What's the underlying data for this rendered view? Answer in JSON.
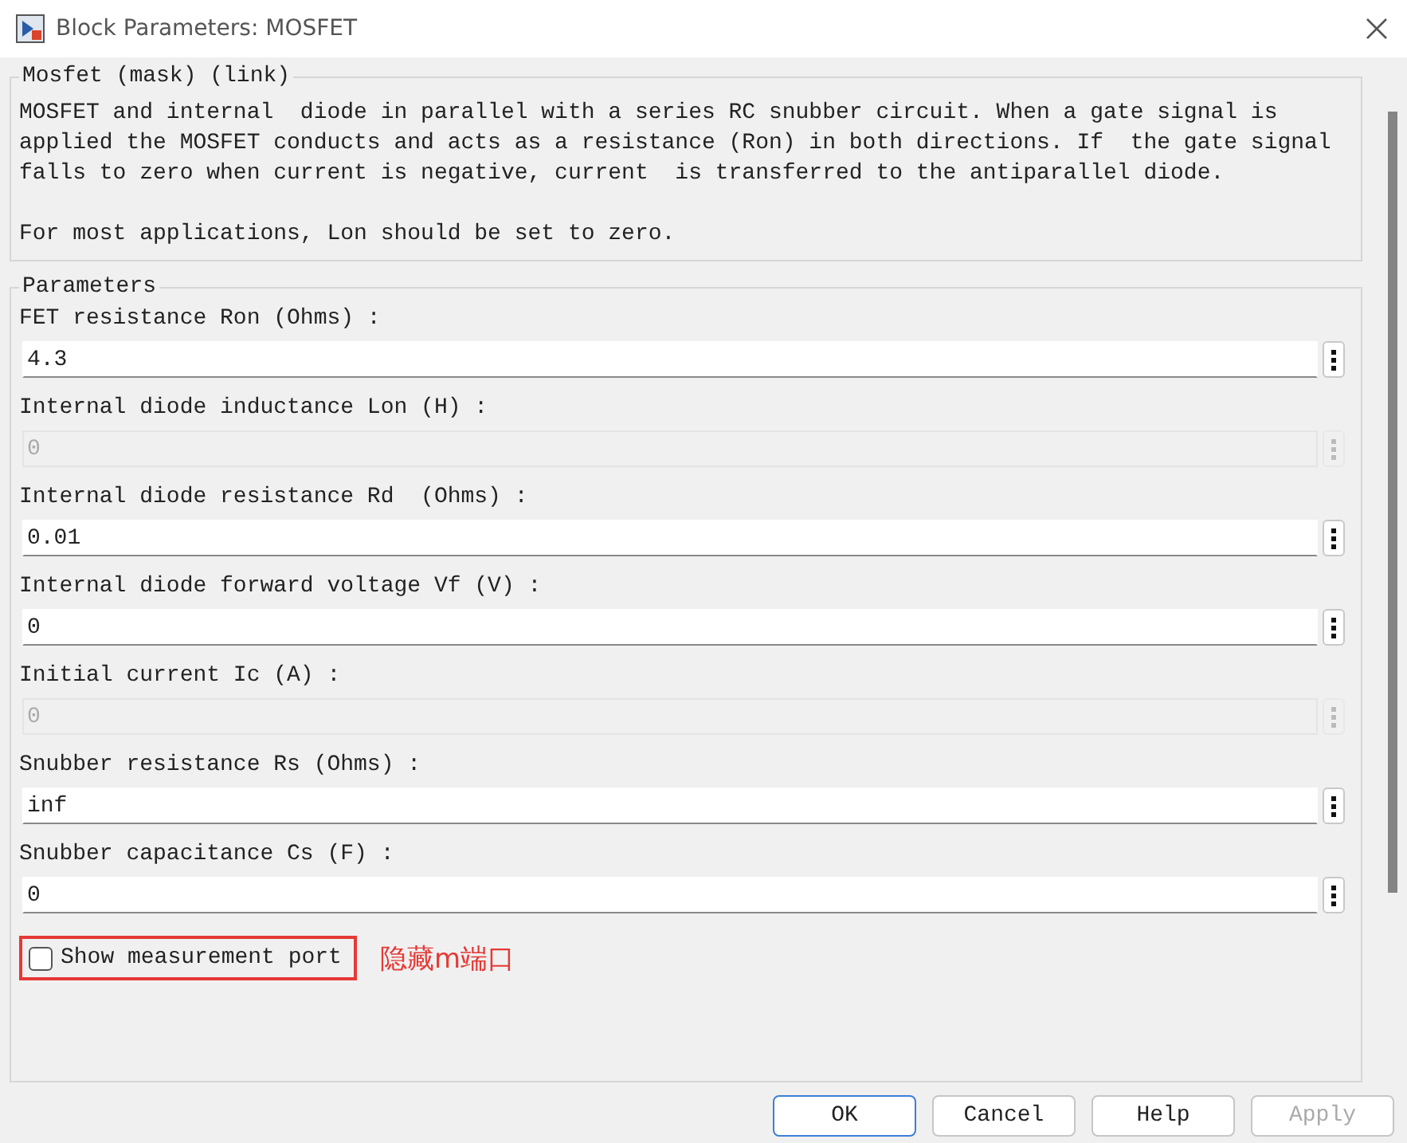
{
  "window": {
    "title": "Block Parameters: MOSFET"
  },
  "description": {
    "title": "Mosfet (mask) (link)",
    "paragraphs": [
      "MOSFET and internal  diode in parallel with a series RC snubber circuit. When a gate signal is applied the MOSFET conducts and acts as a resistance (Ron) in both directions. If  the gate signal falls to zero when current is negative, current  is transferred to the antiparallel diode.",
      "For most applications, Lon should be set to zero."
    ]
  },
  "parameters": {
    "title": "Parameters",
    "fields": [
      {
        "label": "FET resistance Ron (Ohms) :",
        "value": "4.3",
        "disabled": false
      },
      {
        "label": "Internal diode inductance Lon (H) :",
        "value": "0",
        "disabled": true
      },
      {
        "label": "Internal diode resistance Rd  (Ohms) :",
        "value": "0.01",
        "disabled": false
      },
      {
        "label": "Internal diode forward voltage Vf (V) :",
        "value": "0",
        "disabled": false
      },
      {
        "label": "Initial current Ic (A) :",
        "value": "0",
        "disabled": true
      },
      {
        "label": "Snubber resistance Rs (Ohms) :",
        "value": "inf",
        "disabled": false
      },
      {
        "label": "Snubber capacitance Cs (F) :",
        "value": "0",
        "disabled": false
      }
    ],
    "checkbox": {
      "label": "Show measurement port",
      "checked": false
    },
    "annotation": "隐藏m端口"
  },
  "buttons": [
    {
      "label": "OK",
      "default": true,
      "disabled": false
    },
    {
      "label": "Cancel",
      "default": false,
      "disabled": false
    },
    {
      "label": "Help",
      "default": false,
      "disabled": false
    },
    {
      "label": "Apply",
      "default": false,
      "disabled": true
    }
  ]
}
